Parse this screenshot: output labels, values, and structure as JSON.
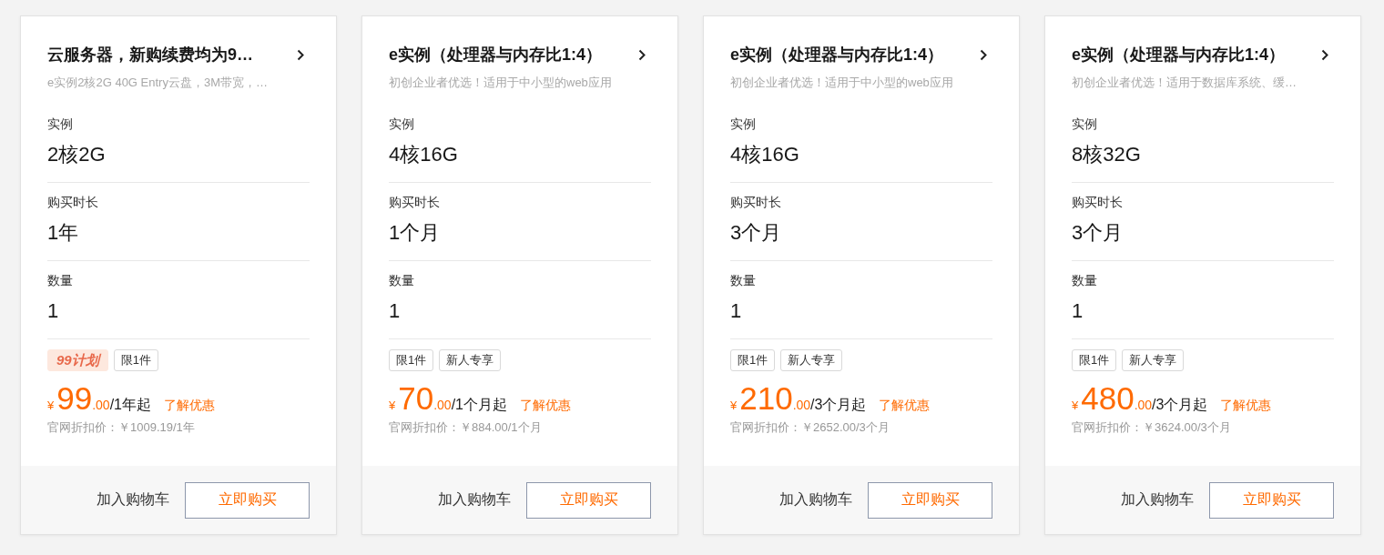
{
  "cards": [
    {
      "title": "云服务器，新购续费均为9…",
      "subtitle": "e实例2核2G 40G Entry云盘，3M带宽，…",
      "specs": [
        {
          "label": "实例",
          "value": "2核2G"
        },
        {
          "label": "购买时长",
          "value": "1年"
        },
        {
          "label": "数量",
          "value": "1"
        }
      ],
      "tags": [
        {
          "kind": "plan",
          "text": "99计划"
        },
        {
          "kind": "label",
          "text": "限1件"
        }
      ],
      "price": {
        "currency": "¥",
        "integer": "99",
        "decimal": ".00",
        "unit": "/1年起"
      },
      "promo_link": "了解优惠",
      "list_price": "官网折扣价：￥1009.19/1年",
      "cart_button": "加入购物车",
      "buy_button": "立即购买"
    },
    {
      "title": "e实例（处理器与内存比1:4）",
      "subtitle": "初创企业者优选！适用于中小型的web应用",
      "specs": [
        {
          "label": "实例",
          "value": "4核16G"
        },
        {
          "label": "购买时长",
          "value": "1个月"
        },
        {
          "label": "数量",
          "value": "1"
        }
      ],
      "tags": [
        {
          "kind": "label",
          "text": "限1件"
        },
        {
          "kind": "label",
          "text": "新人专享"
        }
      ],
      "price": {
        "currency": "¥",
        "integer": "70",
        "decimal": ".00",
        "unit": "/1个月起"
      },
      "promo_link": "了解优惠",
      "list_price": "官网折扣价：￥884.00/1个月",
      "cart_button": "加入购物车",
      "buy_button": "立即购买"
    },
    {
      "title": "e实例（处理器与内存比1:4）",
      "subtitle": "初创企业者优选！适用于中小型的web应用",
      "specs": [
        {
          "label": "实例",
          "value": "4核16G"
        },
        {
          "label": "购买时长",
          "value": "3个月"
        },
        {
          "label": "数量",
          "value": "1"
        }
      ],
      "tags": [
        {
          "kind": "label",
          "text": "限1件"
        },
        {
          "kind": "label",
          "text": "新人专享"
        }
      ],
      "price": {
        "currency": "¥",
        "integer": "210",
        "decimal": ".00",
        "unit": "/3个月起"
      },
      "promo_link": "了解优惠",
      "list_price": "官网折扣价：￥2652.00/3个月",
      "cart_button": "加入购物车",
      "buy_button": "立即购买"
    },
    {
      "title": "e实例（处理器与内存比1:4）",
      "subtitle": "初创企业者优选！适用于数据库系统、缓…",
      "specs": [
        {
          "label": "实例",
          "value": "8核32G"
        },
        {
          "label": "购买时长",
          "value": "3个月"
        },
        {
          "label": "数量",
          "value": "1"
        }
      ],
      "tags": [
        {
          "kind": "label",
          "text": "限1件"
        },
        {
          "kind": "label",
          "text": "新人专享"
        }
      ],
      "price": {
        "currency": "¥",
        "integer": "480",
        "decimal": ".00",
        "unit": "/3个月起"
      },
      "promo_link": "了解优惠",
      "list_price": "官网折扣价：￥3624.00/3个月",
      "cart_button": "加入购物车",
      "buy_button": "立即购买"
    }
  ]
}
